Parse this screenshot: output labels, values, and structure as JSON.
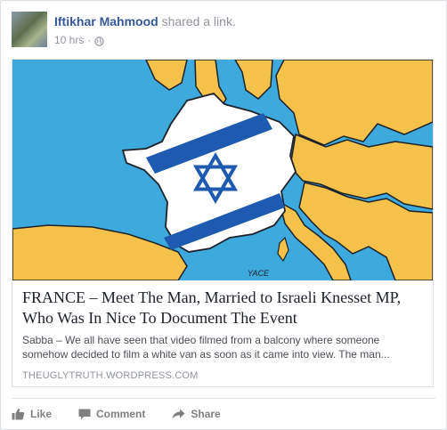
{
  "post": {
    "author": "Iftikhar Mahmood",
    "action_text": "shared a link.",
    "timestamp": "10 hrs",
    "separator": "·",
    "privacy_icon": "globe-icon"
  },
  "link": {
    "image_signature": "YACE",
    "title": "FRANCE – Meet The Man, Married to Israeli Knesset MP, Who Was In Nice To Document The Event",
    "description": "Sabba – We all have seen that video filmed from a balcony where someone somehow decided to film a white van as soon as it came into view. The man...",
    "domain": "THEUGLYTRUTH.WORDPRESS.COM"
  },
  "actions": {
    "like": "Like",
    "comment": "Comment",
    "share": "Share"
  },
  "colors": {
    "author_link": "#365899",
    "sea": "#3ea9dc",
    "land": "#f4c24a",
    "flag_blue": "#1e5bb0"
  }
}
